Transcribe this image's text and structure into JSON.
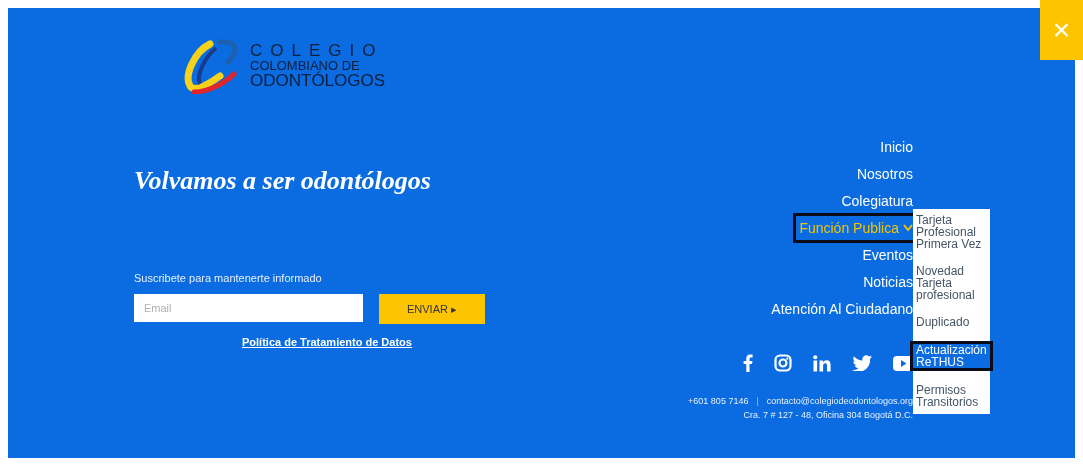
{
  "logo": {
    "line_1": "COLEGIO",
    "line_2": "COLOMBIANO DE",
    "line_3": "ODONTÓLOGOS"
  },
  "tagline": "Volvamos a ser odontólogos",
  "newsletter": {
    "label": "Suscribete para mantenerte informado",
    "placeholder": "Email",
    "button": "ENVIAR ▸",
    "policy_link": "Política de Tratamiento de Datos"
  },
  "nav": [
    {
      "label": "Inicio",
      "selected": false
    },
    {
      "label": "Nosotros",
      "selected": false
    },
    {
      "label": "Colegiatura",
      "selected": false
    },
    {
      "label": "Función Publica",
      "selected": true,
      "submenu": [
        {
          "label": "Tarjeta Profesional Primera Vez",
          "selected": false
        },
        {
          "label": "Novedad Tarjeta profesional",
          "selected": false
        },
        {
          "label": "Duplicado",
          "selected": false
        },
        {
          "label": "Actualización ReTHUS",
          "selected": true
        },
        {
          "label": "Permisos Transitorios",
          "selected": false
        }
      ]
    },
    {
      "label": "Eventos",
      "selected": false
    },
    {
      "label": "Noticias",
      "selected": false
    },
    {
      "label": "Atención Al Ciudadano",
      "selected": false
    }
  ],
  "contact": {
    "phone": "+601 805 7146",
    "separator": "|",
    "email": "contacto@colegiodeodontologos.org",
    "address": "Cra. 7 # 127 - 48, Oficina 304 Bogotá D.C."
  },
  "close_button": "×"
}
